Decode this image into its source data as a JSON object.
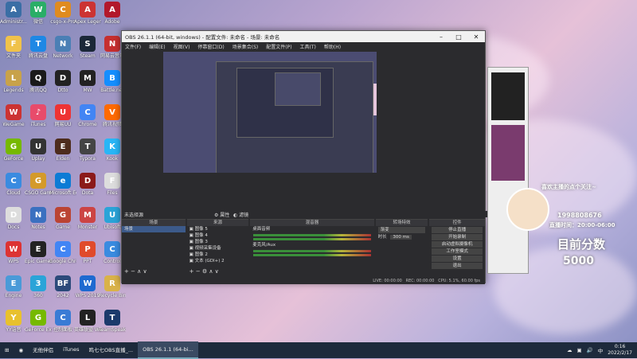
{
  "desktop": {
    "icons": [
      {
        "label": "Administr...",
        "color": "#3a6ea5",
        "glyph": "A"
      },
      {
        "label": "微信",
        "color": "#2aae67",
        "glyph": "W"
      },
      {
        "label": "csgo-x-Pro",
        "color": "#e08b1f",
        "glyph": "C"
      },
      {
        "label": "Apex Legends",
        "color": "#c33",
        "glyph": "A"
      },
      {
        "label": "Adobe",
        "color": "#b2182b",
        "glyph": "A"
      },
      {
        "label": "文件夹",
        "color": "#f0c24a",
        "glyph": "F"
      },
      {
        "label": "腾讯云盘",
        "color": "#1e88e5",
        "glyph": "T"
      },
      {
        "label": "Network",
        "color": "#4a7fb5",
        "glyph": "N"
      },
      {
        "label": "Steam",
        "color": "#1b2838",
        "glyph": "S"
      },
      {
        "label": "网易云音乐",
        "color": "#c62f2f",
        "glyph": "N"
      },
      {
        "label": "Legends",
        "color": "#c8a24a",
        "glyph": "L"
      },
      {
        "label": "腾讯QQ",
        "color": "#1a1a1a",
        "glyph": "Q"
      },
      {
        "label": "Dtto",
        "color": "#222",
        "glyph": "D"
      },
      {
        "label": "MW",
        "color": "#222",
        "glyph": "M"
      },
      {
        "label": "Battle.net",
        "color": "#148eff",
        "glyph": "B"
      },
      {
        "label": "WeGame",
        "color": "#c33",
        "glyph": "W"
      },
      {
        "label": "iTunes",
        "color": "#e84b6b",
        "glyph": "♪"
      },
      {
        "label": "网易UU",
        "color": "#e33",
        "glyph": "U"
      },
      {
        "label": "Chrome",
        "color": "#4285f4",
        "glyph": "C"
      },
      {
        "label": "腾讯视频",
        "color": "#ff6a00",
        "glyph": "V"
      },
      {
        "label": "GeForce",
        "color": "#76b900",
        "glyph": "G"
      },
      {
        "label": "Uplay",
        "color": "#333",
        "glyph": "U"
      },
      {
        "label": "Elden",
        "color": "#4d2c1c",
        "glyph": "E"
      },
      {
        "label": "Typora",
        "color": "#444",
        "glyph": "T"
      },
      {
        "label": "Kook",
        "color": "#29b6f6",
        "glyph": "K"
      },
      {
        "label": "Cloud",
        "color": "#3a8be0",
        "glyph": "C"
      },
      {
        "label": "CSGO Game",
        "color": "#d49a2a",
        "glyph": "G"
      },
      {
        "label": "Microsoft Edge",
        "color": "#0c7bd5",
        "glyph": "e"
      },
      {
        "label": "Dota",
        "color": "#8b1a1a",
        "glyph": "D"
      },
      {
        "label": "Files",
        "color": "#ddd",
        "glyph": "F"
      },
      {
        "label": "Docs",
        "color": "#ddd",
        "glyph": "D"
      },
      {
        "label": "Notes",
        "color": "#3a70c0",
        "glyph": "N"
      },
      {
        "label": "Game",
        "color": "#b43",
        "glyph": "G"
      },
      {
        "label": "Monster",
        "color": "#c44",
        "glyph": "M"
      },
      {
        "label": "Ubisoft",
        "color": "#2aa4d8",
        "glyph": "U"
      },
      {
        "label": "WPS",
        "color": "#d33",
        "glyph": "W"
      },
      {
        "label": "Epic Games Launcher",
        "color": "#222",
        "glyph": "E"
      },
      {
        "label": "Google Chrome",
        "color": "#4285f4",
        "glyph": "C"
      },
      {
        "label": "PPT",
        "color": "#e04a2b",
        "glyph": "P"
      },
      {
        "label": "Control",
        "color": "#3a8be0",
        "glyph": "C"
      },
      {
        "label": "Engine",
        "color": "#4a9ad8",
        "glyph": "E"
      },
      {
        "label": "360",
        "color": "#2aa4d8",
        "glyph": "3"
      },
      {
        "label": "2042",
        "color": "#2c4a7a",
        "glyph": "BF"
      },
      {
        "label": "WPS 2019",
        "color": "#1e6ad0",
        "glyph": "W"
      },
      {
        "label": "Recycle Bin",
        "color": "#d9b24a",
        "glyph": "R"
      },
      {
        "label": "YY语音",
        "color": "#e8c12e",
        "glyph": "Y"
      },
      {
        "label": "GeForce Experience",
        "color": "#76b900",
        "glyph": "G"
      },
      {
        "label": "控制面板",
        "color": "#3a7bd5",
        "glyph": "C"
      },
      {
        "label": "英雄联盟 WeGame",
        "color": "#222",
        "glyph": "L"
      },
      {
        "label": "TeamSpeak 3",
        "color": "#1b3a6b",
        "glyph": "T"
      }
    ]
  },
  "obs": {
    "title": "OBS 26.1.1 (64-bit, windows) - 配置文件: 未命名 - 场景: 未命名",
    "menu": [
      "文件(F)",
      "编辑(E)",
      "视图(V)",
      "停靠窗口(D)",
      "场景集合(S)",
      "配置文件(P)",
      "工具(T)",
      "帮助(H)"
    ],
    "no_source": "未选择源",
    "properties_btn": "属性",
    "filters_btn": "滤镜",
    "docks": {
      "scenes": {
        "title": "场景",
        "items": [
          "场景"
        ]
      },
      "sources": {
        "title": "来源",
        "items": [
          "图像 5",
          "图像 4",
          "图像 3",
          "视频采集设备",
          "图像 2",
          "文本 (GDI+) 2"
        ]
      },
      "mixer": {
        "title": "混音器",
        "channels": [
          {
            "name": "桌面音频",
            "db": "0.0 dB"
          },
          {
            "name": "麦克风/Aux",
            "db": "0.0 dB"
          }
        ]
      },
      "transitions": {
        "title": "转场特效",
        "type": "渐变",
        "duration_label": "时长",
        "duration": "300 ms"
      },
      "controls": {
        "title": "控件",
        "buttons": [
          "停止直播",
          "开始录制",
          "启动虚拟摄像机",
          "工作室模式",
          "设置",
          "退出"
        ]
      }
    },
    "status": {
      "live": "LIVE: 00:00:00",
      "rec": "REC: 00:00:00",
      "cpu": "CPU: 5.1%, 60.00 fps"
    }
  },
  "overlay": {
    "score_label": "目前分数",
    "score_value": "5000",
    "welcome": "喜欢主播的点个关注~",
    "id_line": "1998808676",
    "time_line": "直播时间：20:00-06:00"
  },
  "taskbar": {
    "items": [
      {
        "label": "无他伴侣",
        "active": false
      },
      {
        "label": "iTunes",
        "active": false
      },
      {
        "label": "鸣七七OBS直播_...",
        "active": false
      },
      {
        "label": "OBS 26.1.1 (64-bi...",
        "active": true
      }
    ],
    "lang": "中",
    "time": "0:16",
    "date": "2022/2/17"
  }
}
